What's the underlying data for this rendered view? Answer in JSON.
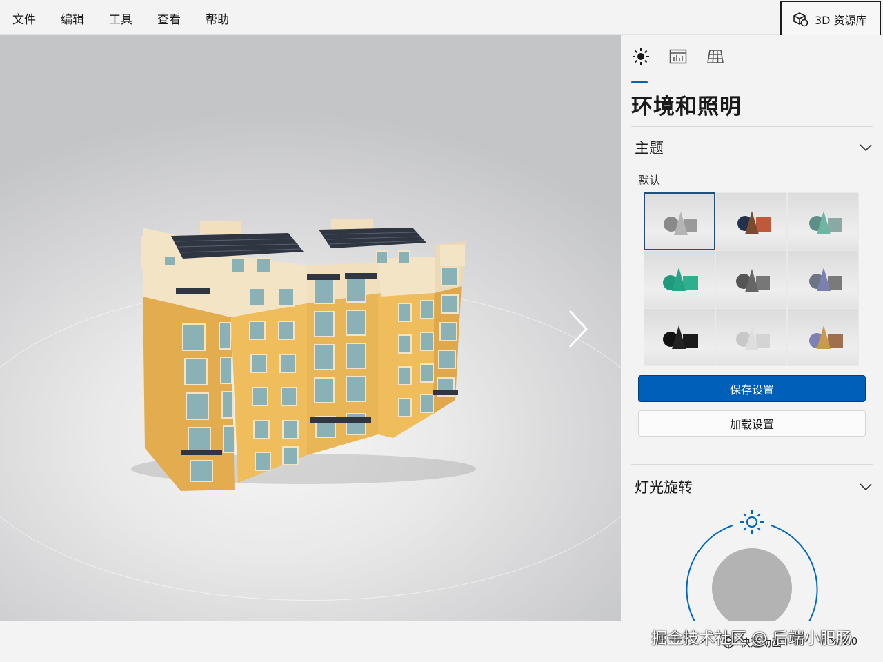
{
  "menubar": {
    "items": [
      "文件",
      "编辑",
      "工具",
      "查看",
      "帮助"
    ],
    "library_button": "3D 资源库"
  },
  "panel": {
    "tabs": [
      {
        "icon": "sun-lighting-icon",
        "active": true
      },
      {
        "icon": "stats-icon",
        "active": false
      },
      {
        "icon": "grid-icon",
        "active": false
      }
    ],
    "title": "环境和照明",
    "theme_section": {
      "heading": "主题",
      "selected_label": "默认",
      "presets": 9,
      "selected_index": 0
    },
    "save_button": "保存设置",
    "load_button": "加载设置",
    "light_section": {
      "heading": "灯光旋转"
    }
  },
  "statusbar": {
    "animation_label": "快速动画",
    "speed": "× 1.0",
    "watermark": "掘金技术社区 @ 后端小肥肠"
  },
  "colors": {
    "accent": "#005fb8",
    "building_wall": "#e8b65a",
    "building_trim": "#f4e4c4",
    "roof_panels": "#2e3440",
    "window": "#88b0b4"
  }
}
